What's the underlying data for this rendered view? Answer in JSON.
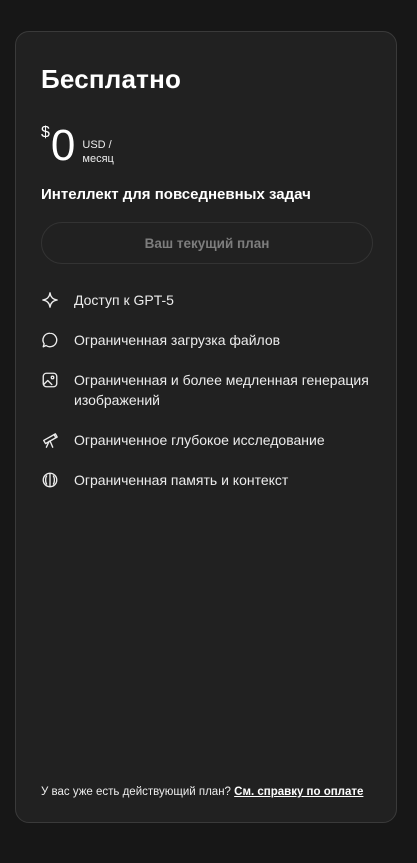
{
  "plan": {
    "title": "Бесплатно",
    "price": {
      "currency": "$",
      "amount": "0",
      "unit_line1": "USD /",
      "unit_line2": "месяц"
    },
    "tagline": "Интеллект для повседневных задач",
    "current_plan_button": "Ваш текущий план",
    "features": [
      {
        "icon": "sparkle-icon",
        "text": "Доступ к GPT-5"
      },
      {
        "icon": "chat-bubble-icon",
        "text": "Ограниченная загрузка файлов"
      },
      {
        "icon": "image-icon",
        "text": "Ограниченная и более медленная генерация изображений"
      },
      {
        "icon": "telescope-icon",
        "text": "Ограниченное глубокое исследование"
      },
      {
        "icon": "brain-icon",
        "text": "Ограниченная память и контекст"
      }
    ]
  },
  "footer": {
    "text": "У вас уже есть действующий план?",
    "link": "См. справку по оплате"
  },
  "colors": {
    "page_background": "#171717",
    "card_background": "#212121",
    "card_border": "#3a3a3a",
    "text_primary": "#ffffff",
    "text_muted": "#7d7d7d"
  }
}
